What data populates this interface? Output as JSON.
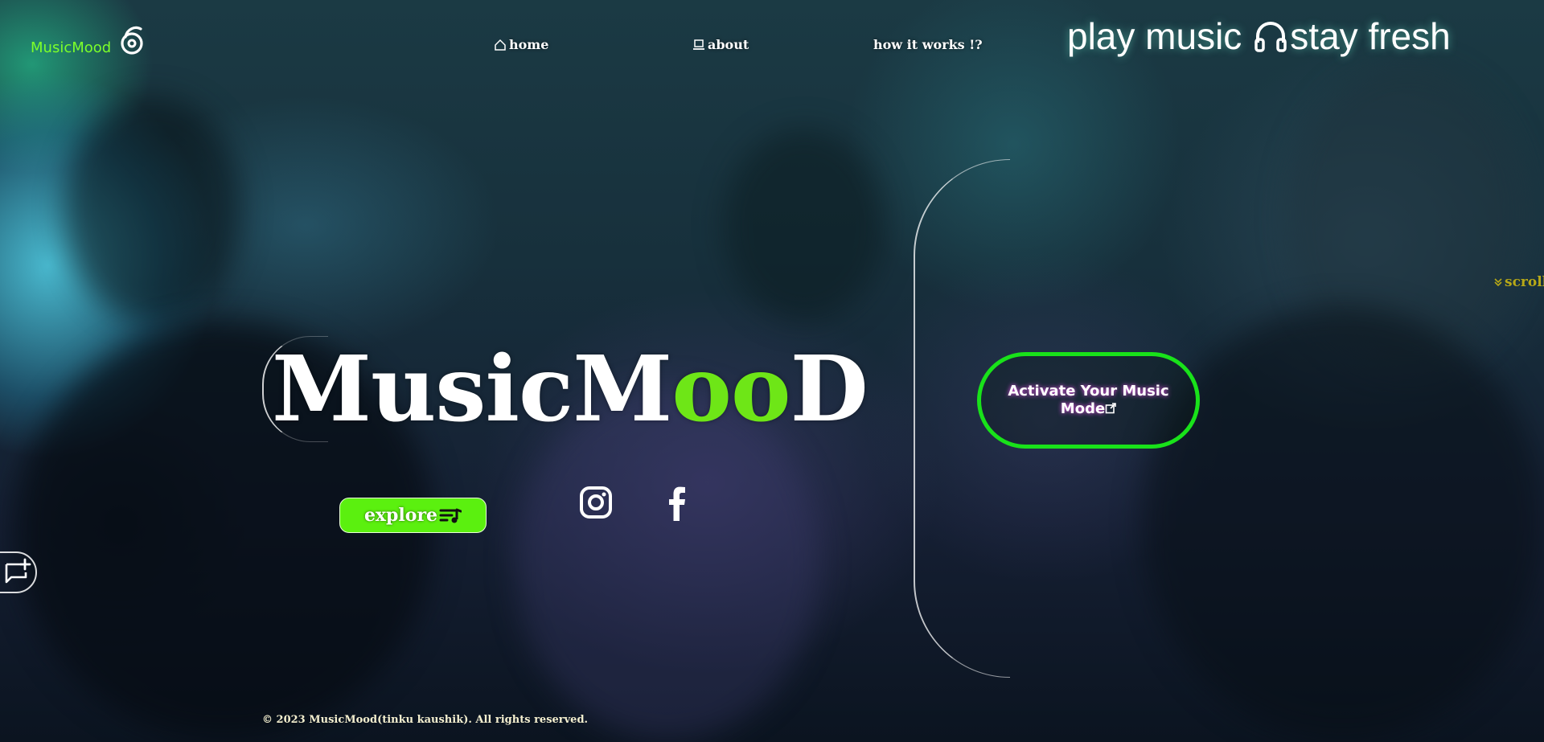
{
  "header": {
    "logo_text": "MusicMood",
    "nav": {
      "home": "home",
      "about": "about",
      "how": "how it works !?"
    },
    "tagline_left": "play music ",
    "tagline_right": "stay fresh"
  },
  "hero": {
    "title_part1": "MusicM",
    "title_accent": "oo",
    "title_part2": "D",
    "explore_label": "explore"
  },
  "panel": {
    "activate_line1": "Activate Your Music",
    "activate_line2": "Mode"
  },
  "scroll_label": "scroll",
  "footer": {
    "copyright": "© 2023 MusicMood(tinku kaushik). All rights reserved."
  },
  "colors": {
    "accent_green": "#6ee617",
    "button_green": "#5bf00f",
    "border_green": "#19e21a",
    "logo_green": "#7cff2a",
    "scroll_gold": "#b7a817"
  },
  "icons": [
    "music-note-logo-icon",
    "home-icon",
    "laptop-icon",
    "headphones-icon",
    "playlist-icon",
    "instagram-icon",
    "facebook-icon",
    "external-link-icon",
    "scroll-down-icon",
    "chat-add-icon"
  ]
}
